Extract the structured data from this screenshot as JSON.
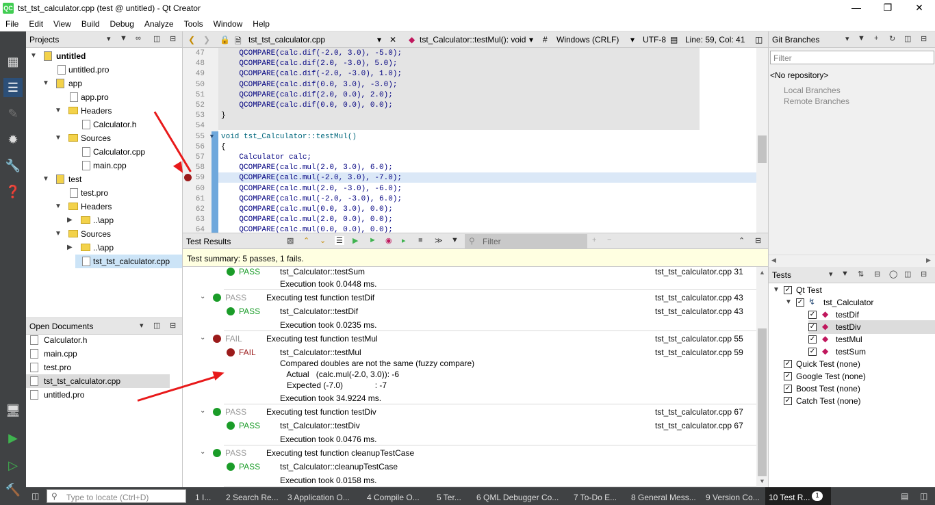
{
  "window": {
    "title": "tst_tst_calculator.cpp (test @ untitled) - Qt Creator",
    "icon": "QC"
  },
  "menu": [
    "File",
    "Edit",
    "View",
    "Build",
    "Debug",
    "Analyze",
    "Tools",
    "Window",
    "Help"
  ],
  "modes": [
    {
      "icon": "grid-icon"
    },
    {
      "icon": "edit-icon"
    },
    {
      "icon": "design-icon"
    },
    {
      "icon": "debug-icon"
    },
    {
      "icon": "projects-icon"
    },
    {
      "icon": "help-icon"
    }
  ],
  "projects": {
    "title": "Projects",
    "tree": [
      {
        "label": "untitled",
        "bold": true
      },
      {
        "label": "untitled.pro"
      },
      {
        "label": "app"
      },
      {
        "label": "app.pro"
      },
      {
        "label": "Headers"
      },
      {
        "label": "Calculator.h"
      },
      {
        "label": "Sources"
      },
      {
        "label": "Calculator.cpp"
      },
      {
        "label": "main.cpp"
      },
      {
        "label": "test"
      },
      {
        "label": "test.pro"
      },
      {
        "label": "Headers"
      },
      {
        "label": "..\\app"
      },
      {
        "label": "Sources"
      },
      {
        "label": "..\\app"
      },
      {
        "label": "tst_tst_calculator.cpp"
      }
    ]
  },
  "open_documents": {
    "title": "Open Documents",
    "items": [
      "Calculator.h",
      "main.cpp",
      "test.pro",
      "tst_tst_calculator.cpp",
      "untitled.pro"
    ]
  },
  "editor_toolbar": {
    "file": "tst_tst_calculator.cpp",
    "function": "tst_Calculator::testMul(): void",
    "hash": "#",
    "line_endings": "Windows (CRLF)",
    "encoding": "UTF-8",
    "position": "Line: 59, Col: 41"
  },
  "code": [
    {
      "n": "47",
      "t": "    QCOMPARE(calc.dif(-2.0, 3.0), -5.0);"
    },
    {
      "n": "48",
      "t": "    QCOMPARE(calc.dif(2.0, -3.0), 5.0);"
    },
    {
      "n": "49",
      "t": "    QCOMPARE(calc.dif(-2.0, -3.0), 1.0);"
    },
    {
      "n": "50",
      "t": "    QCOMPARE(calc.dif(0.0, 3.0), -3.0);"
    },
    {
      "n": "51",
      "t": "    QCOMPARE(calc.dif(2.0, 0.0), 2.0);"
    },
    {
      "n": "52",
      "t": "    QCOMPARE(calc.dif(0.0, 0.0), 0.0);"
    },
    {
      "n": "53",
      "t": "}"
    },
    {
      "n": "54",
      "t": ""
    },
    {
      "n": "55",
      "t": "void tst_Calculator::testMul()"
    },
    {
      "n": "56",
      "t": "{"
    },
    {
      "n": "57",
      "t": "    Calculator calc;"
    },
    {
      "n": "58",
      "t": "    QCOMPARE(calc.mul(2.0, 3.0), 6.0);"
    },
    {
      "n": "59",
      "t": "    QCOMPARE(calc.mul(-2.0, 3.0), -7.0);"
    },
    {
      "n": "60",
      "t": "    QCOMPARE(calc.mul(2.0, -3.0), -6.0);"
    },
    {
      "n": "61",
      "t": "    QCOMPARE(calc.mul(-2.0, -3.0), 6.0);"
    },
    {
      "n": "62",
      "t": "    QCOMPARE(calc.mul(0.0, 3.0), 0.0);"
    },
    {
      "n": "63",
      "t": "    QCOMPARE(calc.mul(2.0, 0.0), 0.0);"
    },
    {
      "n": "64",
      "t": "    QCOMPARE(calc.mul(0.0, 0.0), 0.0);"
    }
  ],
  "test_results": {
    "title": "Test Results",
    "filter_placeholder": "Filter",
    "summary": "Test summary:  5 passes, 1 fails.",
    "rows": [
      {
        "status": "PASS",
        "text": "tst_Calculator::testSum",
        "loc": "tst_tst_calculator.cpp 31",
        "level": 1
      },
      {
        "status": "",
        "text": "Execution took 0.0448 ms.",
        "loc": "",
        "level": 1
      },
      {
        "status": "PASS",
        "text": "Executing test function testDif",
        "loc": "tst_tst_calculator.cpp 43",
        "level": 0
      },
      {
        "status": "PASS",
        "text": "tst_Calculator::testDif",
        "loc": "tst_tst_calculator.cpp 43",
        "level": 1
      },
      {
        "status": "",
        "text": "Execution took 0.0235 ms.",
        "loc": "",
        "level": 1
      },
      {
        "status": "FAIL",
        "text": "Executing test function testMul",
        "loc": "tst_tst_calculator.cpp 55",
        "level": 0
      },
      {
        "status": "FAIL",
        "text": "tst_Calculator::testMul",
        "loc": "tst_tst_calculator.cpp 59",
        "level": 1
      },
      {
        "status": "",
        "text": "Compared doubles are not the same (fuzzy compare)",
        "loc": "",
        "level": 1
      },
      {
        "status": "",
        "text": "   Actual   (calc.mul(-2.0, 3.0)): -6",
        "loc": "",
        "level": 1
      },
      {
        "status": "",
        "text": "   Expected (-7.0)              : -7",
        "loc": "",
        "level": 1
      },
      {
        "status": "",
        "text": "Execution took 34.9224 ms.",
        "loc": "",
        "level": 1
      },
      {
        "status": "PASS",
        "text": "Executing test function testDiv",
        "loc": "tst_tst_calculator.cpp 67",
        "level": 0
      },
      {
        "status": "PASS",
        "text": "tst_Calculator::testDiv",
        "loc": "tst_tst_calculator.cpp 67",
        "level": 1
      },
      {
        "status": "",
        "text": "Execution took 0.0476 ms.",
        "loc": "",
        "level": 1
      },
      {
        "status": "PASS",
        "text": "Executing test function cleanupTestCase",
        "loc": "",
        "level": 0
      },
      {
        "status": "PASS",
        "text": "tst_Calculator::cleanupTestCase",
        "loc": "",
        "level": 1
      },
      {
        "status": "",
        "text": "Execution took 0.0158 ms.",
        "loc": "",
        "level": 1
      }
    ]
  },
  "git": {
    "title": "Git Branches",
    "filter_placeholder": "Filter",
    "no_repo": "<No repository>",
    "local": "Local Branches",
    "remote": "Remote Branches"
  },
  "tests": {
    "title": "Tests",
    "items": [
      "Qt Test",
      "tst_Calculator",
      "testDif",
      "testDiv",
      "testMul",
      "testSum",
      "Quick Test (none)",
      "Google Test (none)",
      "Boost Test (none)",
      "Catch Test (none)"
    ]
  },
  "statusbar": {
    "locator_placeholder": "Type to locate (Ctrl+D)",
    "panes": [
      "1  I...",
      "2  Search Re...",
      "3  Application O...",
      "4  Compile O...",
      "5  Ter...",
      "6  QML Debugger Co...",
      "7  To-Do E...",
      "8  General Mess...",
      "9  Version Co...",
      "10  Test R..."
    ],
    "badge": "1"
  },
  "colors": {
    "pass": "#1a9c28",
    "fail": "#9b1b1b",
    "annotation_arrow": "#e8191a"
  }
}
